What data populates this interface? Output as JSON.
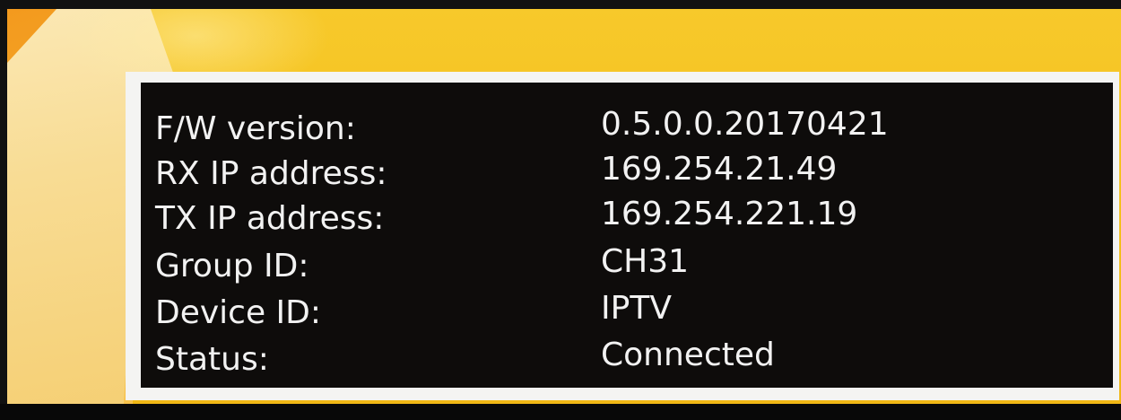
{
  "device_info": {
    "rows": [
      {
        "label": "F/W version:",
        "value": "0.5.0.0.20170421"
      },
      {
        "label": "RX IP address:",
        "value": "169.254.21.49"
      },
      {
        "label": "TX IP address:",
        "value": "169.254.221.19"
      },
      {
        "label": "Group ID:",
        "value": "CH31"
      },
      {
        "label": "Device ID:",
        "value": "IPTV"
      },
      {
        "label": "Status:",
        "value": "Connected"
      }
    ]
  },
  "colors": {
    "panel_background": "#0e0c0b",
    "panel_border": "#f4f4f2",
    "text": "#f2f2f2",
    "wallpaper_yellow": "#f5c21f",
    "wallpaper_orange": "#f39a1e"
  }
}
